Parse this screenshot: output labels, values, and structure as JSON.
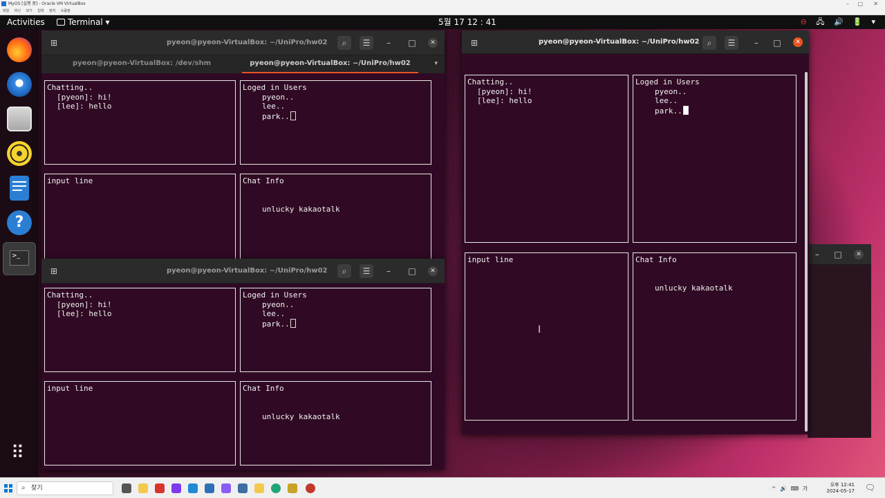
{
  "vbox": {
    "title": "MyOS [실행 중] - Oracle VM VirtualBox",
    "menu": "파일 머신 보기 입력 장치 도움말"
  },
  "topbar": {
    "activities": "Activities",
    "app": "Terminal ▾",
    "clock": "5월 17  12 : 41",
    "tray": [
      "⊖",
      "🖧",
      "🔊",
      "🔋",
      "▾"
    ]
  },
  "dock": {
    "items": [
      "firefox-icon",
      "thunderbird-icon",
      "files-icon",
      "rhythmbox-icon",
      "writer-icon",
      "help-icon",
      "terminal-icon"
    ],
    "terminal_glyph": ">_",
    "apps_grid": "⠿"
  },
  "colors": {
    "terminal_bg": "#300a24",
    "header_bg": "#2b2b2b",
    "accent": "#e95420",
    "close_red": "#e95420"
  },
  "win1": {
    "title": "pyeon@pyeon-VirtualBox: ~/UniPro/hw02",
    "tabs": [
      "pyeon@pyeon-VirtualBox: /dev/shm",
      "pyeon@pyeon-VirtualBox: ~/UniPro/hw02"
    ],
    "tab_arrow": "▾"
  },
  "win2": {
    "title": "pyeon@pyeon-VirtualBox: ~/UniPro/hw02"
  },
  "win3": {
    "title": "pyeon@pyeon-VirtualBox: ~/UniPro/hw02"
  },
  "chat": {
    "chatting_label": "Chatting..",
    "messages": [
      "[pyeon]: hi!",
      "[lee]: hello"
    ],
    "users_label": "Loged in Users",
    "users": [
      "pyeon..",
      "lee..",
      "park.."
    ],
    "input_label": "input line",
    "info_label": "Chat Info",
    "info_text": "unlucky kakaotalk"
  },
  "buttons": {
    "search": "⌕",
    "menu": "☰",
    "minimize": "–",
    "maximize": "□",
    "close": "✕",
    "newtab": "⊞"
  },
  "taskbar": {
    "search_placeholder": "찾기",
    "time": "오후 12:41",
    "date": "2024-05-17",
    "tray": "^ 🔊 ⌨ 가",
    "notification": "🗨"
  }
}
